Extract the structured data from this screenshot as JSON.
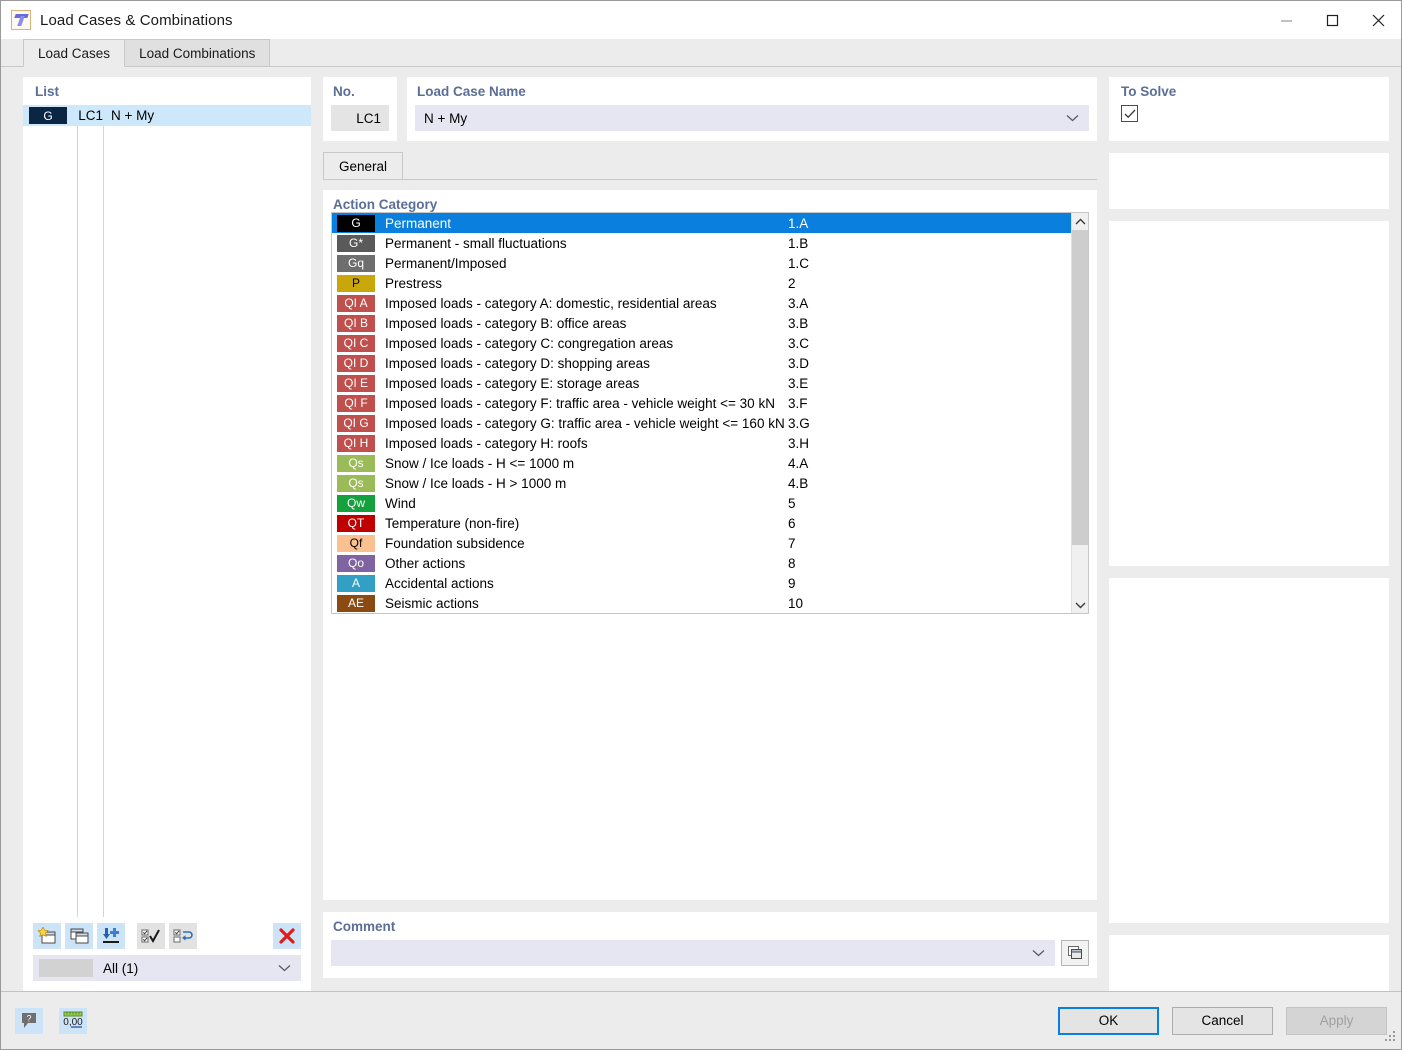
{
  "window": {
    "title": "Load Cases & Combinations",
    "icon": "structural-member-icon",
    "controls": {
      "minimize": "minimize-icon",
      "maximize": "maximize-icon",
      "close": "close-icon"
    }
  },
  "tabs": [
    {
      "label": "Load Cases",
      "active": true
    },
    {
      "label": "Load Combinations",
      "active": false
    }
  ],
  "list": {
    "header": "List",
    "rows": [
      {
        "badge": "G",
        "badge_color": "#0b2545",
        "no": "LC1",
        "name": "N + My"
      }
    ],
    "toolbar": [
      {
        "name": "new-load-case-button",
        "icon": "new-window-star-icon"
      },
      {
        "name": "copy-load-case-button",
        "icon": "copy-windows-icon"
      },
      {
        "name": "insert-load-case-button",
        "icon": "import-plus-icon"
      },
      {
        "name": "select-all-button",
        "icon": "check-all-icon"
      },
      {
        "name": "invert-selection-button",
        "icon": "check-invert-icon"
      },
      {
        "name": "delete-load-case-button",
        "icon": "red-x-icon"
      }
    ],
    "filter": {
      "label": "All (1)",
      "chevron": "chevron-down-icon"
    }
  },
  "no_field": {
    "header": "No.",
    "value": "LC1"
  },
  "name_field": {
    "header": "Load Case Name",
    "value": "N + My",
    "chevron": "chevron-down-icon"
  },
  "to_solve": {
    "header": "To Solve",
    "checked": true,
    "checkmark": "check-icon"
  },
  "inner_tabs": [
    {
      "label": "General",
      "active": true
    }
  ],
  "action_category": {
    "header": "Action Category",
    "selected": {
      "badge": "G",
      "label": "Permanent",
      "code": "1.A",
      "badge_bg": "#000000",
      "badge_fg": "#ffffff"
    },
    "chevron": "chevron-down-icon",
    "dropdown_open": true,
    "scrollbar": {
      "up": "scroll-up-arrow-icon",
      "down": "scroll-down-arrow-icon"
    },
    "options": [
      {
        "badge": "G",
        "label": "Permanent",
        "code": "1.A",
        "bg": "#000000",
        "fg": "#ffffff",
        "selected": true
      },
      {
        "badge": "G*",
        "label": "Permanent - small fluctuations",
        "code": "1.B",
        "bg": "#5a5a5a",
        "fg": "#ffffff",
        "selected": false
      },
      {
        "badge": "Gq",
        "label": "Permanent/Imposed",
        "code": "1.C",
        "bg": "#6e6e6e",
        "fg": "#ffffff",
        "selected": false
      },
      {
        "badge": "P",
        "label": "Prestress",
        "code": "2",
        "bg": "#c9a70a",
        "fg": "#000000",
        "selected": false
      },
      {
        "badge": "QI A",
        "label": "Imposed loads - category A: domestic, residential areas",
        "code": "3.A",
        "bg": "#c0504d",
        "fg": "#ffffff",
        "selected": false
      },
      {
        "badge": "QI B",
        "label": "Imposed loads - category B: office areas",
        "code": "3.B",
        "bg": "#c0504d",
        "fg": "#ffffff",
        "selected": false
      },
      {
        "badge": "QI C",
        "label": "Imposed loads - category C: congregation areas",
        "code": "3.C",
        "bg": "#c0504d",
        "fg": "#ffffff",
        "selected": false
      },
      {
        "badge": "QI D",
        "label": "Imposed loads - category D: shopping areas",
        "code": "3.D",
        "bg": "#c0504d",
        "fg": "#ffffff",
        "selected": false
      },
      {
        "badge": "QI E",
        "label": "Imposed loads - category E: storage areas",
        "code": "3.E",
        "bg": "#c0504d",
        "fg": "#ffffff",
        "selected": false
      },
      {
        "badge": "QI F",
        "label": "Imposed loads - category F: traffic area - vehicle weight <= 30 kN",
        "code": "3.F",
        "bg": "#c0504d",
        "fg": "#ffffff",
        "selected": false
      },
      {
        "badge": "QI G",
        "label": "Imposed loads - category G: traffic area - vehicle weight <= 160 kN",
        "code": "3.G",
        "bg": "#c0504d",
        "fg": "#ffffff",
        "selected": false
      },
      {
        "badge": "QI H",
        "label": "Imposed loads - category H: roofs",
        "code": "3.H",
        "bg": "#c0504d",
        "fg": "#ffffff",
        "selected": false
      },
      {
        "badge": "Qs",
        "label": "Snow / Ice loads - H <= 1000 m",
        "code": "4.A",
        "bg": "#9bbb59",
        "fg": "#ffffff",
        "selected": false
      },
      {
        "badge": "Qs",
        "label": "Snow / Ice loads - H > 1000 m",
        "code": "4.B",
        "bg": "#9bbb59",
        "fg": "#ffffff",
        "selected": false
      },
      {
        "badge": "Qw",
        "label": "Wind",
        "code": "5",
        "bg": "#14a03c",
        "fg": "#ffffff",
        "selected": false
      },
      {
        "badge": "QT",
        "label": "Temperature (non-fire)",
        "code": "6",
        "bg": "#c00000",
        "fg": "#ffffff",
        "selected": false
      },
      {
        "badge": "Qf",
        "label": "Foundation subsidence",
        "code": "7",
        "bg": "#fac090",
        "fg": "#000000",
        "selected": false
      },
      {
        "badge": "Qo",
        "label": "Other actions",
        "code": "8",
        "bg": "#8064a2",
        "fg": "#ffffff",
        "selected": false
      },
      {
        "badge": "A",
        "label": "Accidental actions",
        "code": "9",
        "bg": "#31a0c4",
        "fg": "#ffffff",
        "selected": false
      },
      {
        "badge": "AE",
        "label": "Seismic actions",
        "code": "10",
        "bg": "#8c4a13",
        "fg": "#ffffff",
        "selected": false
      }
    ]
  },
  "comment": {
    "header": "Comment",
    "value": "",
    "placeholder": "",
    "chevron": "chevron-down-icon",
    "button_icon": "select-objects-icon"
  },
  "right_panels": [
    {
      "name": "right-panel-1"
    },
    {
      "name": "right-panel-2"
    },
    {
      "name": "right-panel-3"
    },
    {
      "name": "right-panel-4"
    }
  ],
  "footer": {
    "help_icon": "help-speech-bubble-icon",
    "units_icon": "units-0-00-icon",
    "units_label": "0,00",
    "buttons": [
      {
        "label": "OK",
        "state": "primary"
      },
      {
        "label": "Cancel",
        "state": "normal"
      },
      {
        "label": "Apply",
        "state": "disabled"
      }
    ],
    "grip": "resize-grip-icon"
  }
}
